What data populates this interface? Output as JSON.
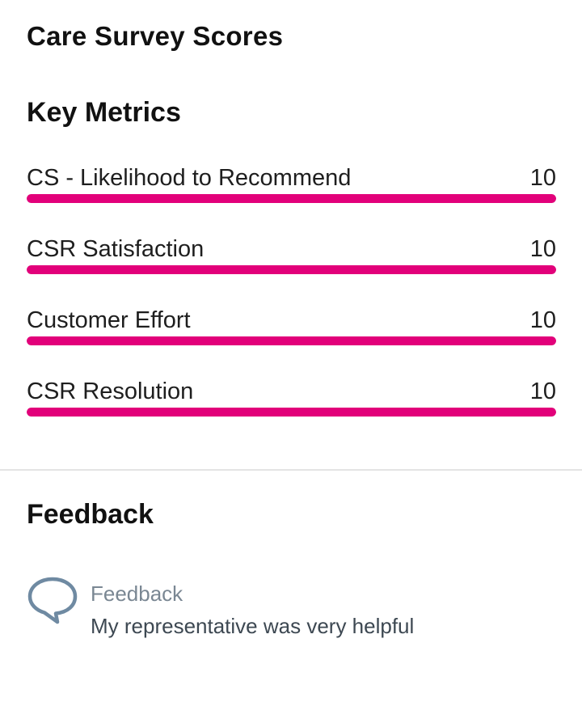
{
  "page": {
    "title": "Care Survey Scores"
  },
  "key_metrics": {
    "heading": "Key Metrics",
    "bar_color": "#e2007a",
    "track_color": "#e8e8e8",
    "max_score": 10,
    "items": [
      {
        "label": "CS - Likelihood to Recommend",
        "value": "10",
        "fill_fraction": 1.0
      },
      {
        "label": "CSR Satisfaction",
        "value": "10",
        "fill_fraction": 1.0
      },
      {
        "label": "Customer Effort",
        "value": "10",
        "fill_fraction": 1.0
      },
      {
        "label": "CSR Resolution",
        "value": "10",
        "fill_fraction": 1.0
      }
    ]
  },
  "feedback": {
    "heading": "Feedback",
    "item": {
      "icon": "speech-bubble-icon",
      "icon_color": "#6f8aa2",
      "label": "Feedback",
      "text": "My representative was very helpful"
    }
  }
}
